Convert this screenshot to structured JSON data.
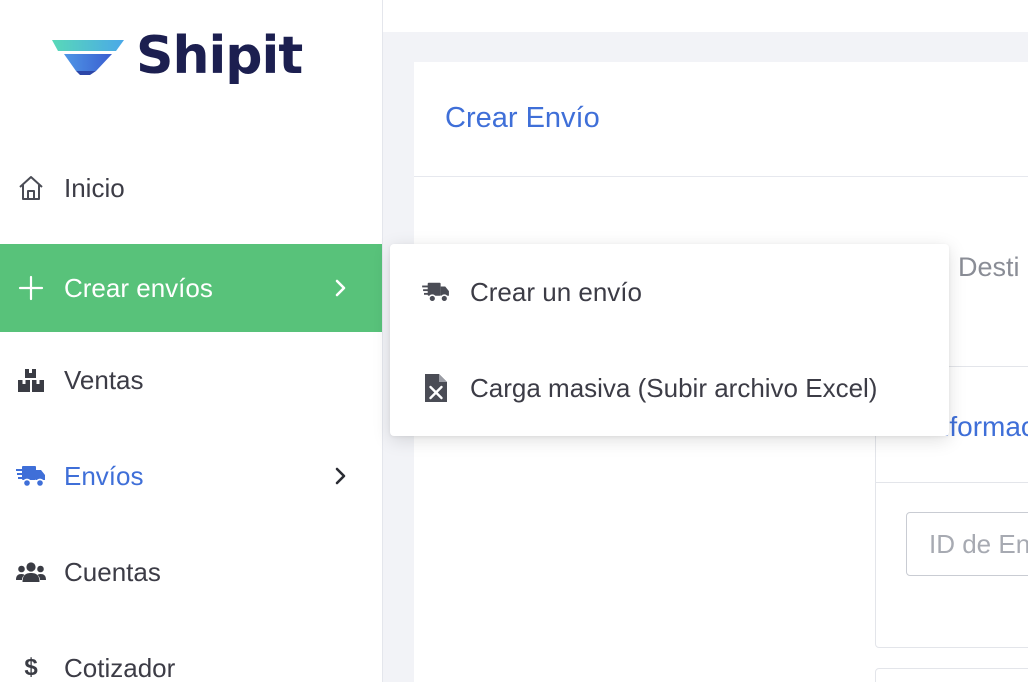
{
  "brand": {
    "name": "Shipit",
    "colors": {
      "logo_text": "#1c1f50",
      "logo_wing_top": "#5fd3c0",
      "logo_wing_bottom": "#3f6fd8"
    }
  },
  "colors": {
    "accent_green": "#58c27a",
    "accent_blue": "#3f6fd8"
  },
  "sidebar": {
    "items": [
      {
        "label": "Inicio",
        "icon": "home-icon",
        "state": "default"
      },
      {
        "label": "Crear envíos",
        "icon": "plus-icon",
        "state": "active",
        "has_submenu": true
      },
      {
        "label": "Ventas",
        "icon": "boxes-icon",
        "state": "default"
      },
      {
        "label": "Envíos",
        "icon": "truck-icon",
        "state": "highlighted",
        "has_submenu": true
      },
      {
        "label": "Cuentas",
        "icon": "users-icon",
        "state": "default"
      },
      {
        "label": "Cotizador",
        "icon": "dollar-icon",
        "state": "default"
      }
    ]
  },
  "main": {
    "title": "Crear Envío",
    "step_label": "Desti",
    "section_title": "Informac",
    "id_input": {
      "placeholder": "ID de En",
      "value": ""
    }
  },
  "dropdown": {
    "items": [
      {
        "label": "Crear un envío",
        "icon": "truck-icon"
      },
      {
        "label": "Carga masiva (Subir archivo Excel)",
        "icon": "excel-file-icon"
      }
    ]
  }
}
